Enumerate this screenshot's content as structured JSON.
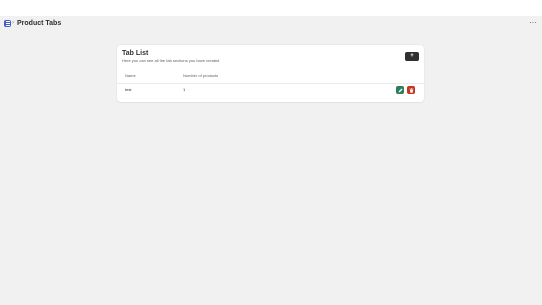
{
  "header": {
    "app_icon": "app-menu-icon",
    "separator": "›",
    "title": "Product Tabs",
    "more_icon": "more-horizontal-icon",
    "more_glyph": "···"
  },
  "card": {
    "title": "Tab List",
    "subtitle": "Here you can see all the tab sections you have created",
    "add_button": {
      "label": "+",
      "icon": "plus-icon"
    },
    "table": {
      "columns": [
        "Name",
        "Number of products"
      ],
      "rows": [
        {
          "name": "test",
          "count": "1",
          "actions": [
            "edit-icon",
            "delete-icon"
          ]
        }
      ]
    }
  },
  "colors": {
    "background": "#f1f1f1",
    "app_icon": "#4a5ccc",
    "edit_button": "#2f7d5b",
    "delete_button": "#c9341c",
    "primary_button": "#303030"
  }
}
